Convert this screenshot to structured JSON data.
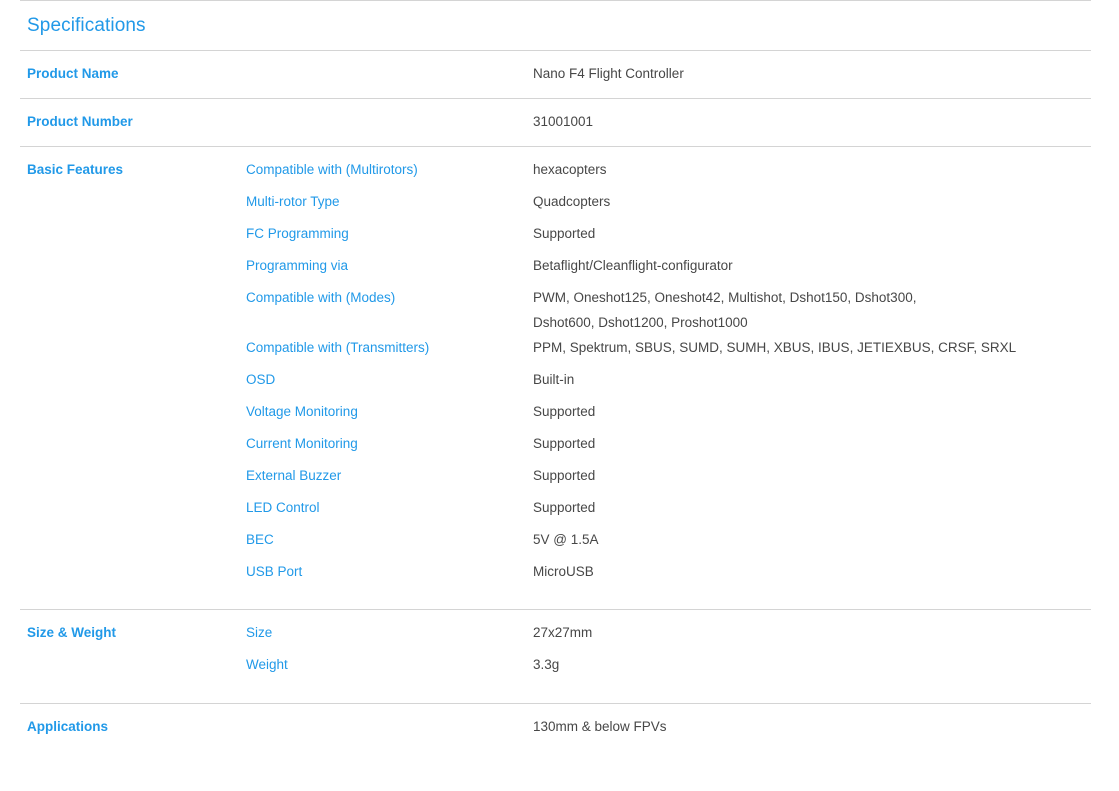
{
  "section": {
    "title": "Specifications",
    "accent_color": "#2199e8",
    "value_color": "#474747",
    "divider_color": "#d4d4d4"
  },
  "rows": [
    {
      "group": "Product Name",
      "value": "Nano F4 Flight Controller"
    },
    {
      "group": "Product Number",
      "value": "31001001"
    },
    {
      "group": "Basic Features",
      "items": [
        {
          "label": "Compatible with (Multirotors)",
          "value": "hexacopters"
        },
        {
          "label": "Multi-rotor Type",
          "value": "Quadcopters"
        },
        {
          "label": "FC Programming",
          "value": "Supported"
        },
        {
          "label": "Programming via",
          "value": "Betaflight/Cleanflight-configurator"
        },
        {
          "label": "Compatible with (Modes)",
          "value_lines": [
            "PWM, Oneshot125, Oneshot42, Multishot, Dshot150, Dshot300,",
            "Dshot600, Dshot1200, Proshot1000"
          ]
        },
        {
          "label": "Compatible with (Transmitters)",
          "value": "PPM, Spektrum, SBUS, SUMD, SUMH, XBUS, IBUS, JETIEXBUS, CRSF, SRXL"
        },
        {
          "label": "OSD",
          "value": "Built-in"
        },
        {
          "label": "Voltage Monitoring",
          "value": "Supported"
        },
        {
          "label": "Current Monitoring",
          "value": "Supported"
        },
        {
          "label": "External Buzzer",
          "value": "Supported"
        },
        {
          "label": "LED Control",
          "value": "Supported"
        },
        {
          "label": "BEC",
          "value": "5V @ 1.5A"
        },
        {
          "label": "USB Port",
          "value": "MicroUSB"
        }
      ]
    },
    {
      "group": "Size & Weight",
      "items": [
        {
          "label": "Size",
          "value": "27x27mm"
        },
        {
          "label": "Weight",
          "value": "3.3g"
        }
      ]
    },
    {
      "group": "Applications",
      "value": "130mm & below FPVs"
    }
  ]
}
